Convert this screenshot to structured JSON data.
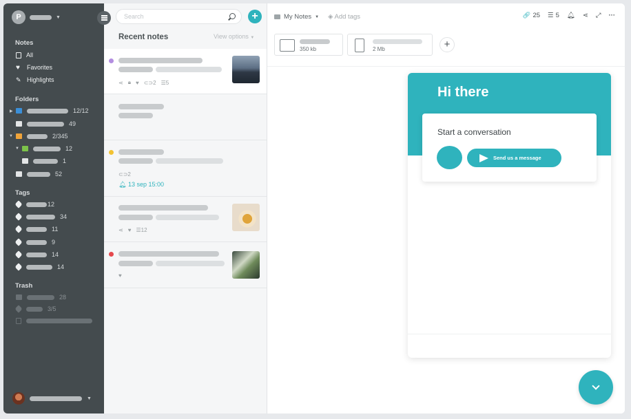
{
  "account": {
    "initial": "P"
  },
  "sidebar": {
    "notes_header": "Notes",
    "notes_items": [
      "All",
      "Favorites",
      "Highlights"
    ],
    "folders_header": "Folders",
    "folders": [
      {
        "count": "12/12"
      },
      {
        "count": "49"
      },
      {
        "count": "2/345"
      },
      {
        "count": "12"
      },
      {
        "count": "1"
      },
      {
        "count": "52"
      }
    ],
    "tags_header": "Tags",
    "tags": [
      {
        "count": "12"
      },
      {
        "count": "34"
      },
      {
        "count": "11"
      },
      {
        "count": "9"
      },
      {
        "count": "14"
      },
      {
        "count": "14"
      }
    ],
    "trash_header": "Trash",
    "trash": [
      {
        "count": "28"
      },
      {
        "count": "3/5"
      }
    ]
  },
  "list": {
    "search_placeholder": "Search",
    "add_label": "+",
    "title": "Recent notes",
    "view_options": "View options",
    "notes": [
      {
        "dot_color": "#b38ee0",
        "links": "2",
        "tasks": "5"
      },
      {},
      {
        "dot_color": "#f2c232",
        "links": "2",
        "reminder": "13 sep 15:00"
      },
      {
        "tasks": "12"
      },
      {
        "dot_color": "#e5484d"
      }
    ]
  },
  "main": {
    "breadcrumb": "My Notes",
    "add_tags": "Add tags",
    "links_count": "25",
    "tasks_count": "5",
    "attachments": [
      {
        "type": "video",
        "size": "350 kb"
      },
      {
        "type": "archive",
        "size": "2 Mb"
      }
    ],
    "add_attachment": "+"
  },
  "chat": {
    "greeting": "Hi there",
    "card_title": "Start a conversation",
    "send_label": "Send us a message"
  },
  "colors": {
    "accent": "#2fb3bd",
    "sidebar_bg": "#444b4e"
  }
}
